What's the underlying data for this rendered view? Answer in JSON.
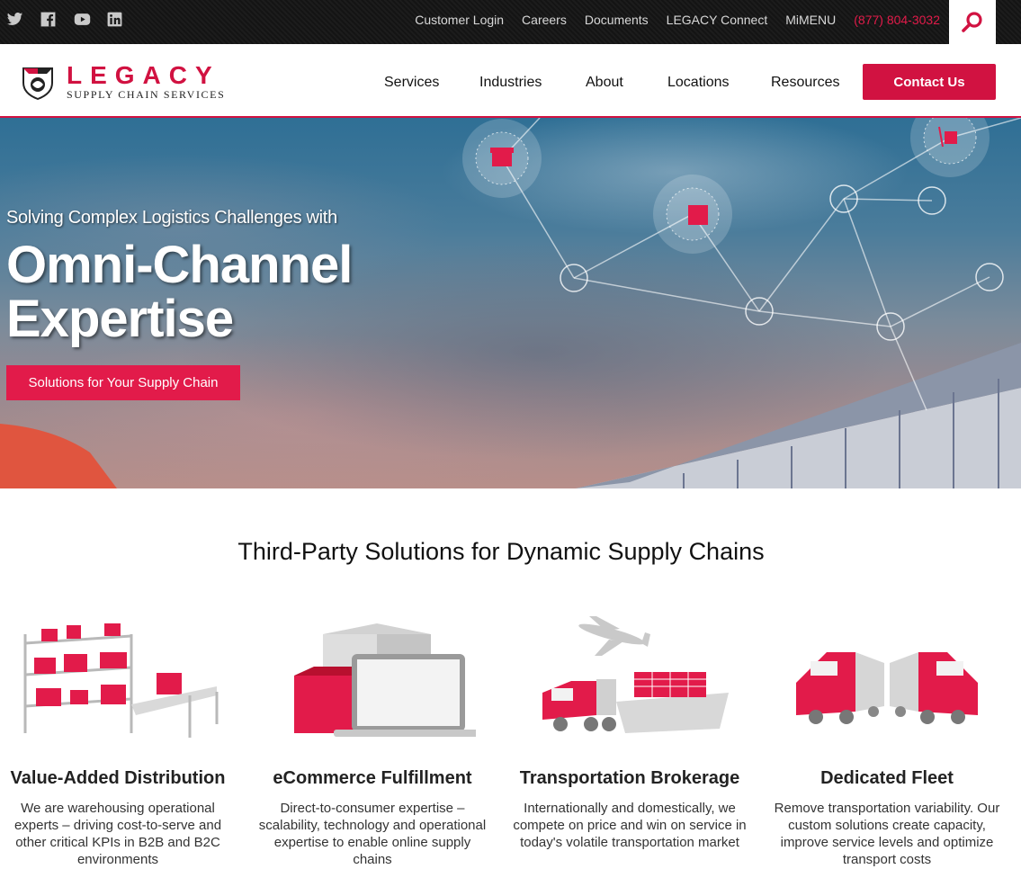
{
  "topbar": {
    "social": [
      "twitter-icon",
      "facebook-icon",
      "youtube-icon",
      "linkedin-icon"
    ],
    "links": [
      "Customer Login",
      "Careers",
      "Documents",
      "LEGACY Connect",
      "MiMENU"
    ],
    "phone": "(877) 804-3032"
  },
  "header": {
    "logo_name": "LEGACY",
    "logo_sub": "SUPPLY CHAIN SERVICES",
    "nav": [
      "Services",
      "Industries",
      "About",
      "Locations",
      "Resources"
    ],
    "contact_label": "Contact Us"
  },
  "hero": {
    "pretitle": "Solving Complex Logistics Challenges with",
    "title_line1": "Omni-Channel",
    "title_line2": "Expertise",
    "button_label": "Solutions for Your Supply Chain"
  },
  "section": {
    "title": "Third-Party Solutions for Dynamic Supply Chains",
    "cards": [
      {
        "title": "Value-Added Distribution",
        "desc": "We are warehousing operational experts – driving cost-to-serve and other critical KPIs in B2B and B2C environments"
      },
      {
        "title": "eCommerce Fulfillment",
        "desc": "Direct-to-consumer expertise – scalability, technology and operational expertise to enable online supply chains"
      },
      {
        "title": "Transportation Brokerage",
        "desc": "Internationally and domestically, we compete on price and win on service in today's volatile transportation market"
      },
      {
        "title": "Dedicated Fleet",
        "desc": "Remove transportation variability. Our custom solutions create capacity, improve service levels and optimize transport costs"
      }
    ]
  },
  "colors": {
    "brand": "#d11241",
    "accent": "#e21b4a",
    "topbar": "#1a1a1a"
  }
}
